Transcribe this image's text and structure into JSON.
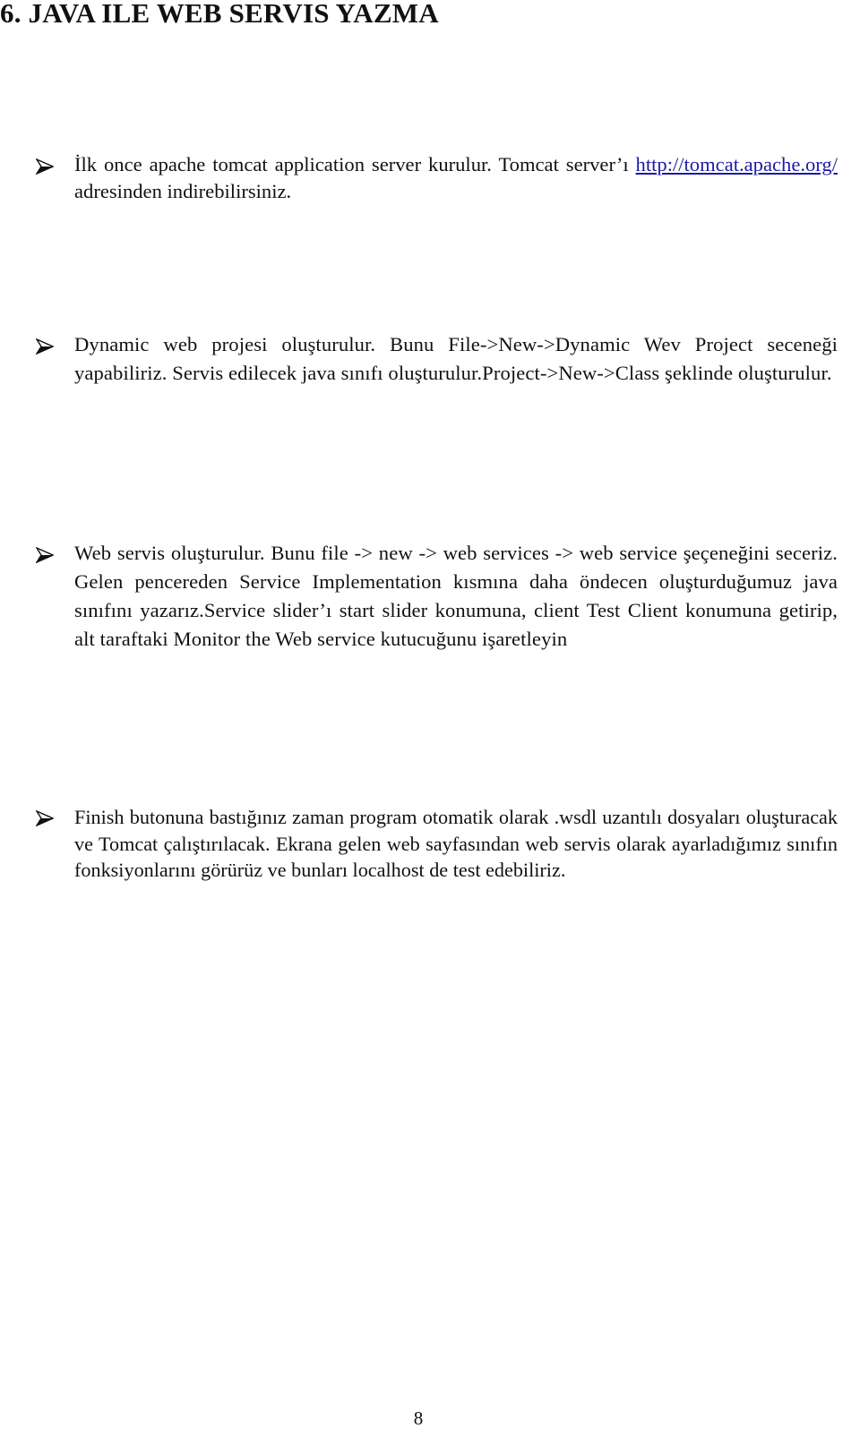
{
  "document": {
    "heading": "6. JAVA ILE WEB SERVIS YAZMA",
    "bullet_icon": "arrowhead-bullet-icon",
    "bullets": [
      {
        "parts": {
          "before_link": "İlk once apache tomcat application server kurulur. Tomcat server’ı ",
          "link_text": "http://tomcat.apache.org/",
          "after_link": " adresinden indirebilirsiniz."
        }
      },
      {
        "text": "Dynamic web projesi oluşturulur. Bunu File->New->Dynamic Wev Project seceneği yapabiliriz. Servis edilecek java sınıfı oluşturulur.Project->New->Class şeklinde oluşturulur."
      },
      {
        "text": "Web servis oluşturulur. Bunu file -> new -> web services -> web service şeçeneğini seceriz. Gelen pencereden Service Implementation kısmına daha öndecen oluşturduğumuz java sınıfını yazarız.Service slider’ı start slider konumuna, client Test Client konumuna getirip, alt taraftaki Monitor the Web service kutucuğunu işaretleyin"
      },
      {
        "text": "Finish butonuna bastığınız zaman program otomatik olarak .wsdl uzantılı dosyaları oluşturacak ve Tomcat çalıştırılacak. Ekrana gelen web sayfasından web servis olarak ayarladığımız sınıfın fonksiyonlarını görürüz ve bunları localhost de test edebiliriz."
      }
    ],
    "page_number": "8"
  },
  "colors": {
    "text": "#111111",
    "link": "#1a1aa8",
    "background": "#ffffff"
  }
}
